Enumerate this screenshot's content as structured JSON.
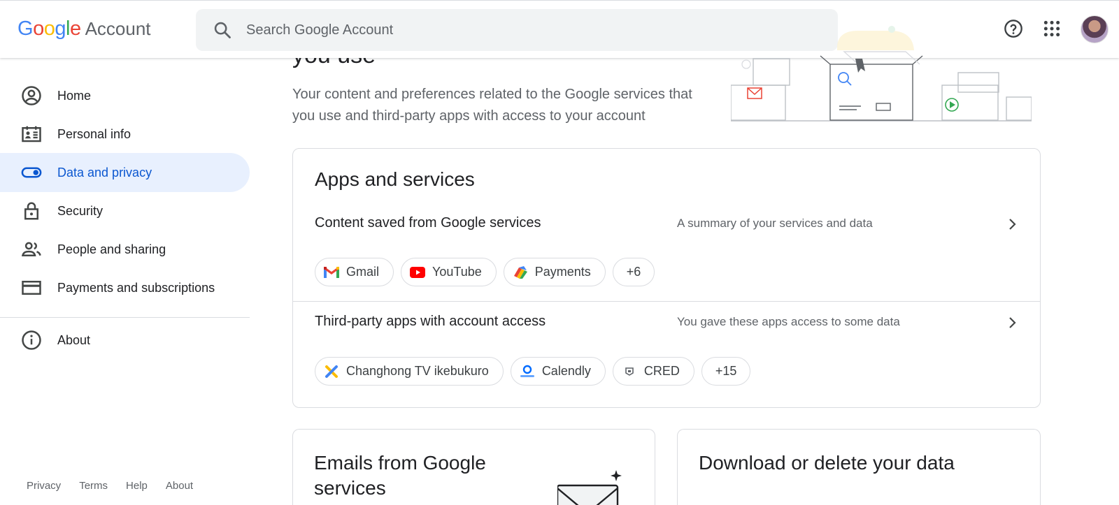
{
  "header": {
    "logo_google": "Google",
    "logo_account": "Account",
    "search_placeholder": "Search Google Account"
  },
  "sidebar": {
    "items": [
      {
        "label": "Home",
        "icon": "account-circle-icon"
      },
      {
        "label": "Personal info",
        "icon": "id-card-icon"
      },
      {
        "label": "Data and privacy",
        "icon": "toggle-icon",
        "active": true
      },
      {
        "label": "Security",
        "icon": "lock-icon"
      },
      {
        "label": "People and sharing",
        "icon": "people-icon"
      },
      {
        "label": "Payments and subscriptions",
        "icon": "credit-card-icon"
      },
      {
        "label": "About",
        "icon": "info-icon"
      }
    ],
    "footer": [
      "Privacy",
      "Terms",
      "Help",
      "About"
    ]
  },
  "hero": {
    "title": "you use",
    "description": "Your content and preferences related to the Google services that you use and third-party apps with access to your account"
  },
  "apps_card": {
    "title": "Apps and services",
    "content_saved": {
      "title": "Content saved from Google services",
      "desc": "A summary of your services and data",
      "chips": [
        "Gmail",
        "YouTube",
        "Payments"
      ],
      "more": "+6"
    },
    "third_party": {
      "title": "Third-party apps with account access",
      "desc": "You gave these apps access to some data",
      "chips": [
        "Changhong TV ikebukuro",
        "Calendly",
        "CRED"
      ],
      "more": "+15"
    }
  },
  "emails_card": {
    "title": "Emails from Google services"
  },
  "download_card": {
    "title": "Download or delete your data"
  },
  "colors": {
    "accent": "#0b57d0",
    "active_bg": "#e8f0fe",
    "text_secondary": "#5f6368",
    "border": "#dadce0"
  }
}
